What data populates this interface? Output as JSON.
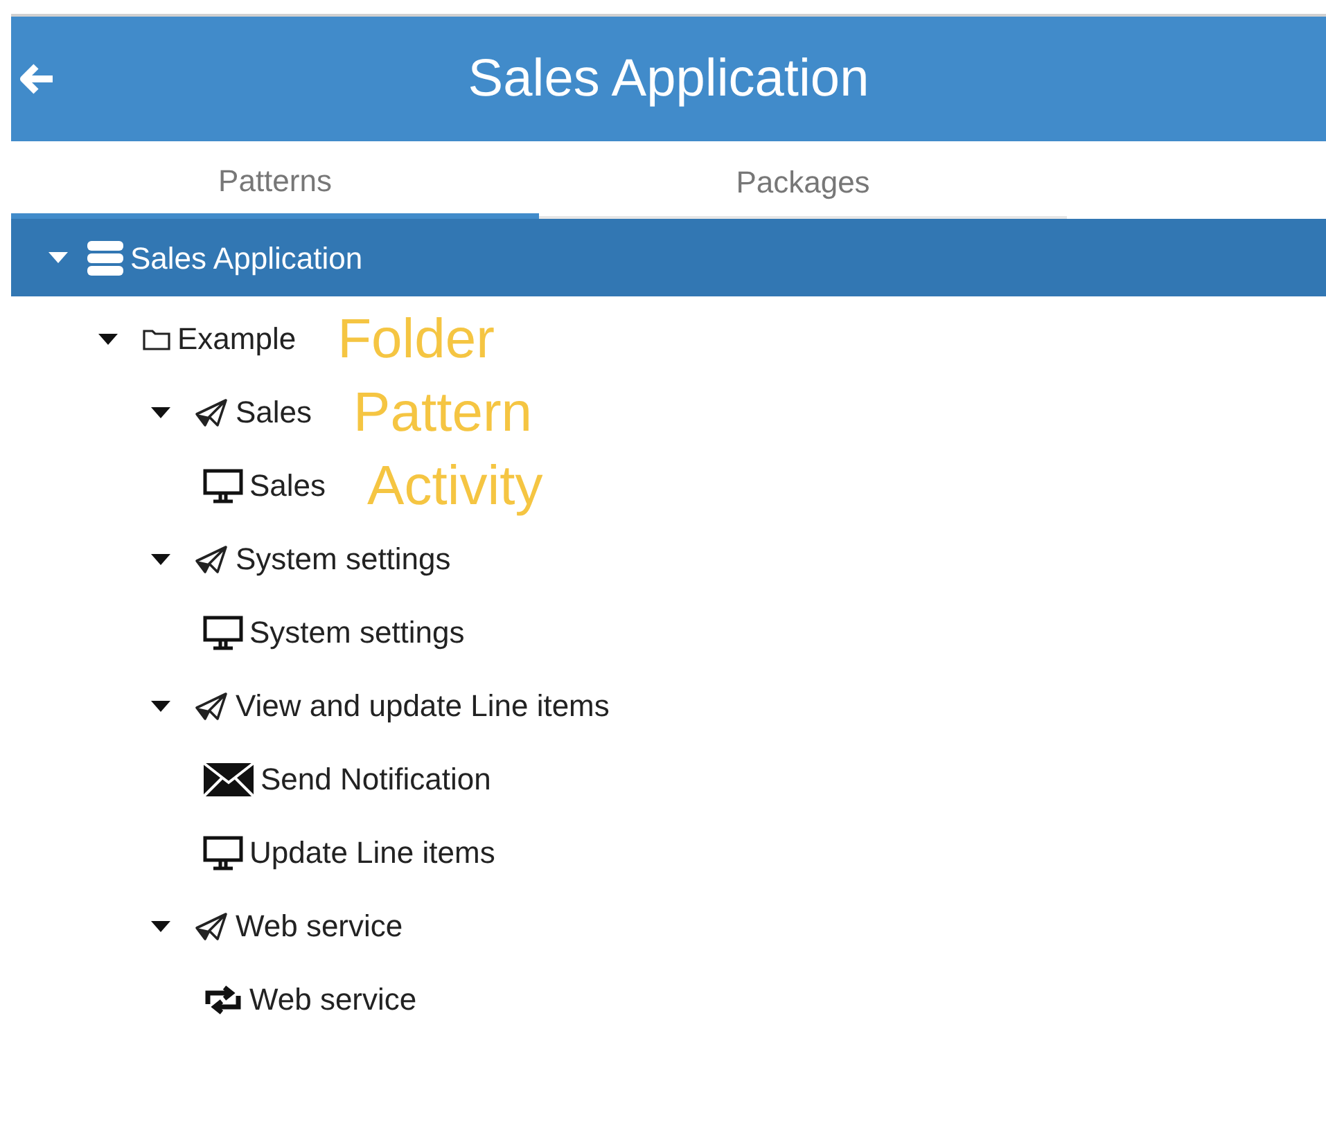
{
  "header": {
    "title": "Sales Application"
  },
  "tabs": [
    {
      "label": "Patterns",
      "selected": true
    },
    {
      "label": "Packages",
      "selected": false
    }
  ],
  "tree": {
    "label": "Sales Application",
    "expanded": true,
    "children": [
      {
        "label": "Example",
        "kind": "folder",
        "expanded": true,
        "annotation": "Folder",
        "children": [
          {
            "label": "Sales",
            "kind": "pattern",
            "expanded": true,
            "annotation": "Pattern",
            "children": [
              {
                "label": "Sales",
                "kind": "screen_activity",
                "annotation": "Activity"
              }
            ]
          },
          {
            "label": "System settings",
            "kind": "pattern",
            "expanded": true,
            "children": [
              {
                "label": "System settings",
                "kind": "screen_activity"
              }
            ]
          },
          {
            "label": "View and update Line items",
            "kind": "pattern",
            "expanded": true,
            "children": [
              {
                "label": "Send Notification",
                "kind": "mail_activity"
              },
              {
                "label": "Update Line items",
                "kind": "screen_activity"
              }
            ]
          },
          {
            "label": "Web service",
            "kind": "pattern",
            "expanded": true,
            "children": [
              {
                "label": "Web service",
                "kind": "service_activity"
              }
            ]
          }
        ]
      }
    ]
  }
}
